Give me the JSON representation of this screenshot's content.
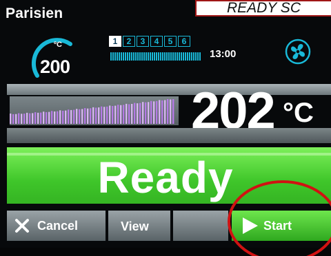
{
  "header": {
    "recipe_name": "Parisien",
    "callout_text": "READY SC"
  },
  "setpoint": {
    "unit": "ºC",
    "value": "200",
    "gauge_level": 0.45
  },
  "steps": {
    "items": [
      "1",
      "2",
      "3",
      "4",
      "5",
      "6"
    ],
    "active_index": 0
  },
  "timer": {
    "time": "13:00"
  },
  "temperature": {
    "value": "202",
    "unit": "°C"
  },
  "status": {
    "label": "Ready"
  },
  "buttons": {
    "cancel": "Cancel",
    "view": "View",
    "blank": "",
    "start": "Start"
  },
  "colors": {
    "accent_cyan": "#19b9d8",
    "ready_green": "#45cc2f",
    "graph_purple": "#b57ae6",
    "annotation_red": "#d01212"
  },
  "icons": {
    "fan": "fan-icon",
    "cancel": "close-icon",
    "start": "play-icon"
  }
}
